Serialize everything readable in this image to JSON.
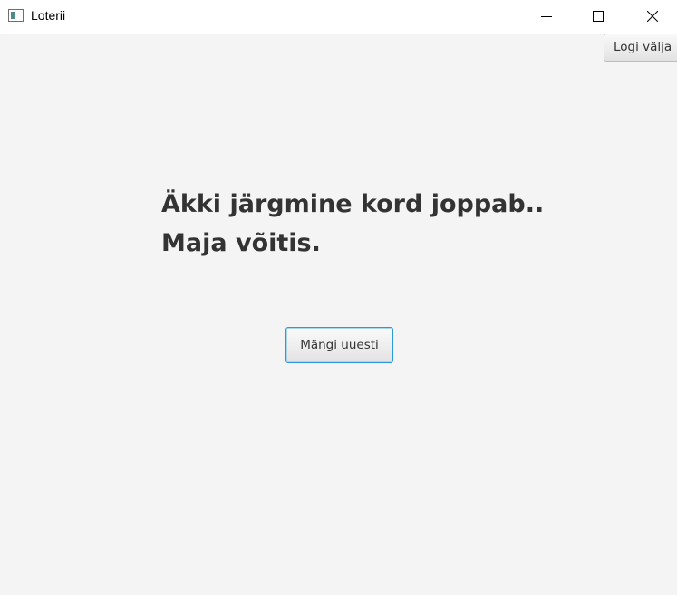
{
  "window": {
    "title": "Loterii",
    "controls": {
      "minimize_icon": "minimize-icon",
      "maximize_icon": "maximize-icon",
      "close_icon": "close-icon"
    }
  },
  "header": {
    "logout_label": "Logi välja"
  },
  "main": {
    "message_line1": "Äkki järgmine kord joppab..",
    "message_line2": "Maja võitis.",
    "play_again_label": "Mängi uuesti"
  },
  "colors": {
    "background": "#f4f4f4",
    "titlebar": "#ffffff",
    "text": "#333333",
    "focus_accent": "#2a9ad8"
  }
}
